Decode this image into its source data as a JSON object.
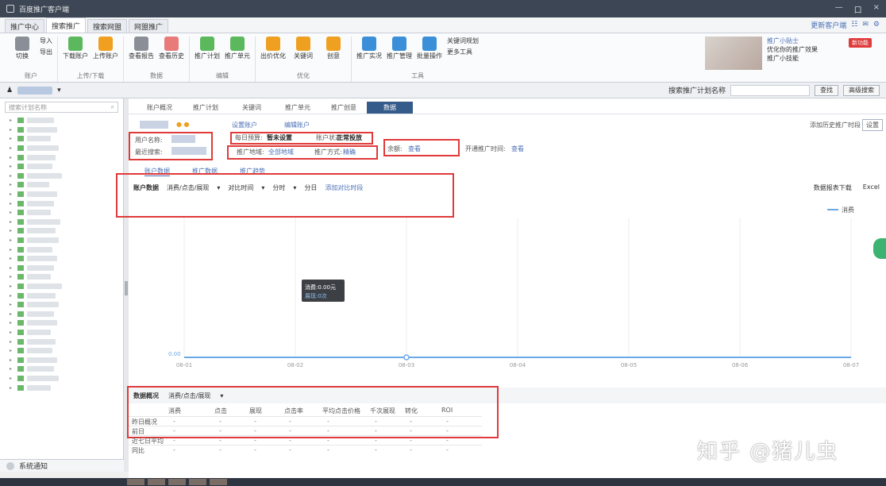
{
  "window": {
    "title": "百度推广客户端",
    "controls": [
      "—",
      "口",
      "×"
    ]
  },
  "tabs": [
    {
      "label": "推广中心",
      "active": false
    },
    {
      "label": "搜索推广",
      "active": true
    },
    {
      "label": "搜索网盟",
      "active": false
    },
    {
      "label": "网盟推广",
      "active": false
    }
  ],
  "tabs_right": {
    "link": "更新客户端",
    "icons": [
      "grid-icon",
      "mail-icon",
      "gear-icon"
    ]
  },
  "ribbon": {
    "groups": [
      {
        "name": "账户",
        "buttons": [
          "切换"
        ],
        "small": [
          "导入",
          "导出"
        ]
      },
      {
        "name": "上传/下载",
        "buttons": [
          "下载账户",
          "上传账户"
        ]
      },
      {
        "name": "数据",
        "buttons": [
          "查看报告",
          "查看历史"
        ]
      },
      {
        "name": "编辑",
        "buttons": [
          "推广计划",
          "推广单元"
        ]
      },
      {
        "name": "优化",
        "buttons": [
          "出价优化",
          "关键词",
          "创意"
        ]
      },
      {
        "name": "工具",
        "buttons": [
          "推广实况",
          "推广管理",
          "批量操作"
        ],
        "small": [
          "关键词规划",
          "更多工具"
        ]
      }
    ],
    "promo": {
      "title": "推广小贴士",
      "lines": [
        "优化你的推广效果",
        "推广小技能"
      ],
      "badge": "新功能"
    }
  },
  "acctbar": {
    "search_placeholder": "搜索推广计划名称",
    "btn_search": "查找",
    "btn_adv": "高级搜索"
  },
  "sidebar": {
    "search_placeholder": "搜索计划名称",
    "footer": "系统通知"
  },
  "subtabs": [
    "账户概况",
    "推广计划",
    "关键词",
    "推广单元",
    "推广创意",
    "数据"
  ],
  "account_info": {
    "user_label": "用户名称:",
    "recent_label": "最近搜索:",
    "budget_label": "每日预算:",
    "budget_value": "暂未设置",
    "status_label": "账户状态:",
    "status_value": "正常投放",
    "region_label": "推广地域:",
    "region_value": "全部地域",
    "adv_label": "推广方式:",
    "adv_value": "精确",
    "balance_label": "余额:",
    "balance_value": "查看",
    "extra_label": "开通推广时间:",
    "extra_value": "查看",
    "links": [
      "设置账户",
      "编辑账户"
    ],
    "right_link": "添加历史推广时段",
    "right_btn": "设置"
  },
  "section_nav": [
    "账户数据",
    "推广数据",
    "推广趋势"
  ],
  "filter_row": {
    "title": "账户数据",
    "options": [
      "消费/点击/展现",
      "对比时间",
      "分时",
      "分日",
      "添加对比时段"
    ],
    "right": [
      "数据报表下载",
      "Excel"
    ]
  },
  "chart_data": {
    "type": "line",
    "legend": "消费",
    "legend_position": "top-right",
    "x": [
      "08-01",
      "08-02",
      "08-03",
      "08-04",
      "08-05",
      "08-06",
      "08-07"
    ],
    "series": [
      {
        "name": "消费",
        "values": [
          0,
          0,
          0,
          0,
          0,
          0,
          0
        ]
      }
    ],
    "tooltip": {
      "line1": "消费:0.00元",
      "line2": "展现:0次"
    },
    "y_first_label": "0.00",
    "grid": true
  },
  "table": {
    "title": "数据概况",
    "subtitle": "消费/点击/展现",
    "columns": [
      "消费",
      "点击",
      "展现",
      "点击率",
      "平均点击价格",
      "千次展现",
      "转化",
      "ROI"
    ],
    "rows": [
      {
        "label": "昨日概况",
        "values": [
          "-",
          "-",
          "-",
          "-",
          "-",
          "-",
          "-",
          "-"
        ]
      },
      {
        "label": "前日",
        "values": [
          "-",
          "-",
          "-",
          "-",
          "-",
          "-",
          "-",
          "-"
        ]
      },
      {
        "label": "近七日平均",
        "values": [
          "-",
          "-",
          "-",
          "-",
          "-",
          "-",
          "-",
          "-"
        ]
      },
      {
        "label": "同比",
        "values": [
          "-",
          "-",
          "-",
          "-",
          "-",
          "-",
          "-",
          "-"
        ]
      }
    ]
  },
  "watermark": "知乎 @猪儿虫"
}
